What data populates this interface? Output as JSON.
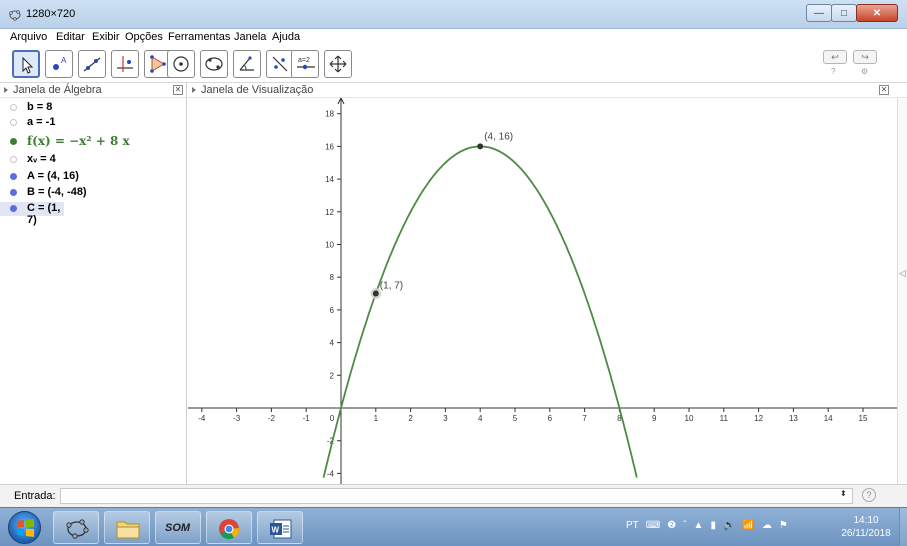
{
  "window": {
    "title": "1280×720",
    "min_symbol": "—",
    "max_symbol": "□",
    "close_symbol": "✕"
  },
  "menu": [
    "Arquivo",
    "Editar",
    "Exibir",
    "Opções",
    "Ferramentas",
    "Janela",
    "Ajuda"
  ],
  "toolbar": {
    "tools": [
      "move-tool",
      "point-tool",
      "line-tool",
      "perpendicular-tool",
      "polygon-tool",
      "circle-tool",
      "conic-tool",
      "angle-tool",
      "reflect-tool",
      "slider-tool",
      "move-view-tool"
    ],
    "slider_label": "a=2",
    "undo_symbol": "↩",
    "redo_symbol": "↪",
    "help_symbol": "?",
    "settings_symbol": "⚙"
  },
  "algebra": {
    "title": "Janela de Álgebra",
    "close_symbol": "✕",
    "items": [
      {
        "text": "b = 8",
        "dot": "hidden"
      },
      {
        "text": "a = -1",
        "dot": "hidden"
      },
      {
        "text": "f(x) = −x² + 8 x",
        "dot": "green"
      },
      {
        "text": "xᵥ = 4",
        "dot": "hidden"
      },
      {
        "text": "A = (4, 16)",
        "dot": "blue"
      },
      {
        "text": "B = (-4, -48)",
        "dot": "blue"
      },
      {
        "text": "C = (1, 7)",
        "dot": "blue",
        "selected": true
      }
    ]
  },
  "view": {
    "title": "Janela de Visualização",
    "close_symbol": "✕",
    "collapse_symbol": "◁"
  },
  "chart_data": {
    "type": "line",
    "function": "f(x) = -x^2 + 8x",
    "x_ticks": [
      -4,
      -3,
      -2,
      -1,
      0,
      1,
      2,
      3,
      4,
      5,
      6,
      7,
      8,
      9,
      10,
      11,
      12,
      13,
      14,
      15
    ],
    "y_ticks": [
      -4,
      -2,
      2,
      4,
      6,
      8,
      10,
      12,
      14,
      16,
      18
    ],
    "xlim": [
      -4.5,
      15.5
    ],
    "ylim": [
      -4.5,
      19
    ],
    "curve_color": "#4e8a43",
    "points": [
      {
        "x": 4,
        "y": 16,
        "label": "(4, 16)"
      },
      {
        "x": 1,
        "y": 7,
        "label": "(1, 7)",
        "selected": true
      }
    ]
  },
  "input": {
    "label": "Entrada:",
    "value": "",
    "stepper_symbol": "⬍",
    "help_symbol": "?"
  },
  "taskbar": {
    "apps": [
      "geogebra-app",
      "file-explorer-app",
      "som-app",
      "chrome-app",
      "word-app"
    ],
    "som_label": "SOM",
    "tray": [
      "PT",
      "⌨",
      "❷",
      "ˆ",
      "▲",
      "▮",
      "🔈",
      "📶",
      "☁",
      "⚑"
    ],
    "time": "14:10",
    "date": "26/11/2018"
  }
}
